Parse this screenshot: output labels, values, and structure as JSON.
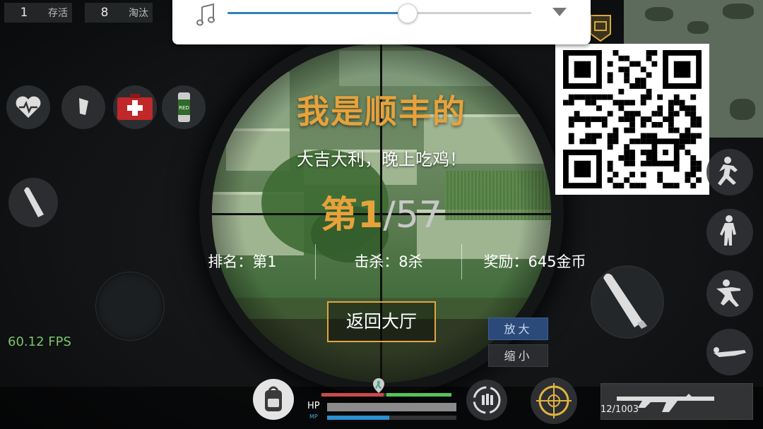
{
  "counters": [
    {
      "value": "1",
      "label": "存活"
    },
    {
      "value": "8",
      "label": "淘汰"
    }
  ],
  "music": {
    "icon": "music-note-icon",
    "volume_fraction": 0.594
  },
  "result": {
    "title": "我是顺丰的",
    "subtitle": "大吉大利，晚上吃鸡！",
    "rank_prefix": "第",
    "rank_value": "1",
    "rank_sep": "/",
    "rank_total": "57",
    "stats": {
      "rank": "排名：第1",
      "kills": "击杀：8杀",
      "reward": "奖励：645金币"
    },
    "return_button": "返回大厅"
  },
  "zoom": {
    "in": "放大",
    "out": "缩小"
  },
  "fps": "60.12 FPS",
  "hud": {
    "hp_label": "HP",
    "mp_label": "MP",
    "hp_fraction": 0.0,
    "mp_fraction": 0.48,
    "ammo": "12/1003"
  },
  "colors": {
    "accent": "#e7a23c",
    "fps": "#7bc36a",
    "mp": "#2b8fd0"
  }
}
